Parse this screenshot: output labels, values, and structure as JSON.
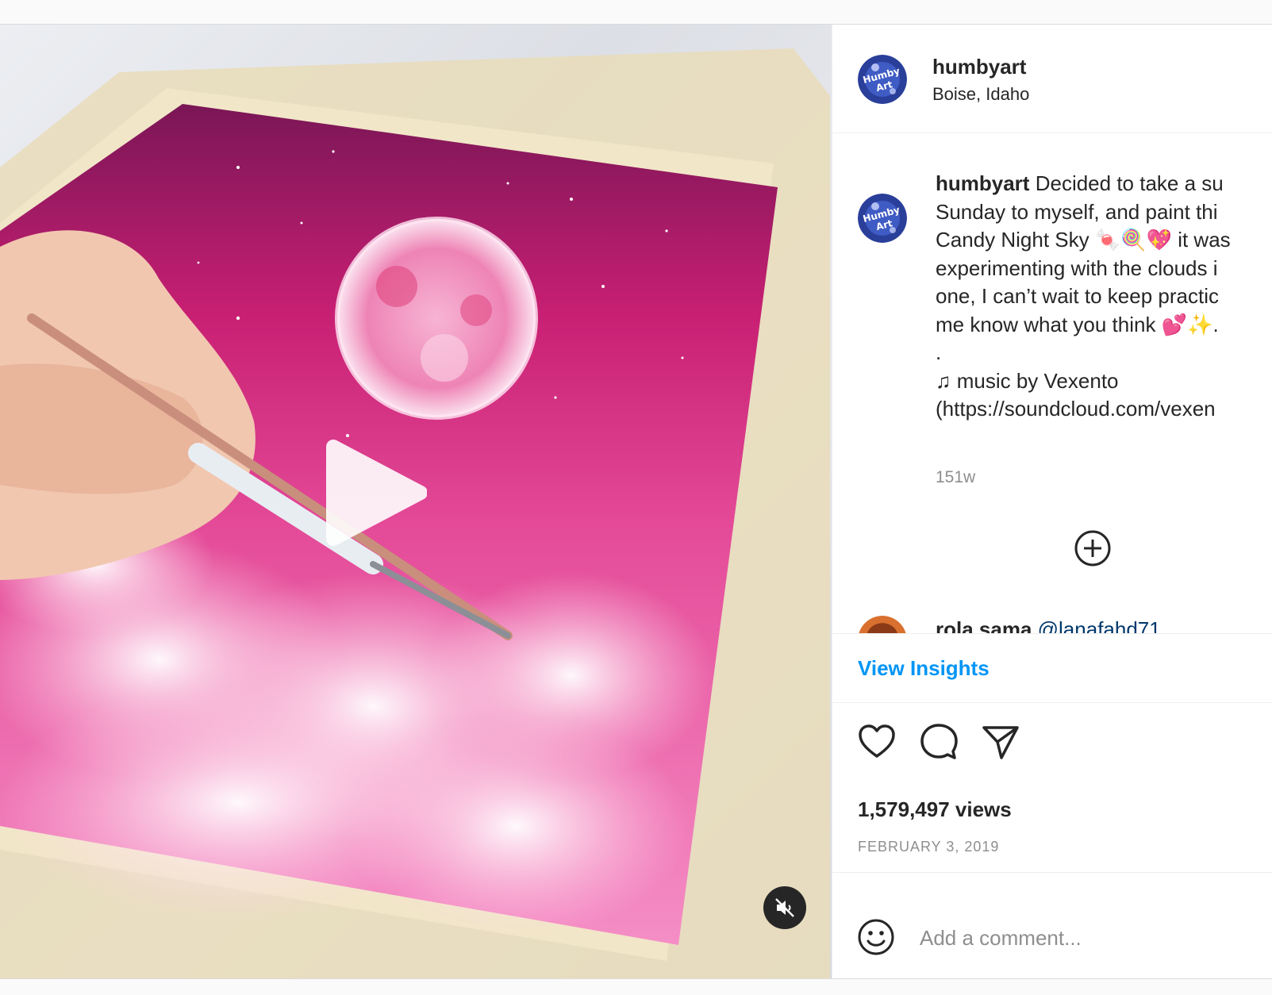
{
  "post": {
    "author": "humbyart",
    "location": "Boise, Idaho",
    "caption": {
      "username": "humbyart",
      "lines": [
        "Decided to take a su",
        "Sunday to myself, and paint thi",
        "Candy Night Sky 🍬🍭💖 it was",
        "experimenting with the clouds i",
        "one, I can’t wait to keep practic",
        "me know what you think 💕✨.",
        ".",
        "♫ music by Vexento",
        "(https://soundcloud.com/vexen"
      ]
    },
    "age": "151w",
    "reply": {
      "username": "rola.sama",
      "mention": "@lanafahd71"
    },
    "insights_label": "View Insights",
    "views": "1,579,497 views",
    "date": "FEBRUARY 3, 2019",
    "comment_placeholder": "Add a comment...",
    "avatar_text": "Humby Art"
  },
  "icons": {
    "play": "play-icon",
    "mute": "muted-speaker-icon",
    "load_more": "plus-circle-icon",
    "like": "heart-icon",
    "comment": "comment-bubble-icon",
    "share": "paper-plane-icon",
    "emoji": "smiley-icon"
  },
  "colors": {
    "link": "#0095f6",
    "mention": "#00376b",
    "muted_text": "#8e8e8e",
    "sky_top": "#7a1656",
    "sky_bottom": "#f28cc2"
  }
}
